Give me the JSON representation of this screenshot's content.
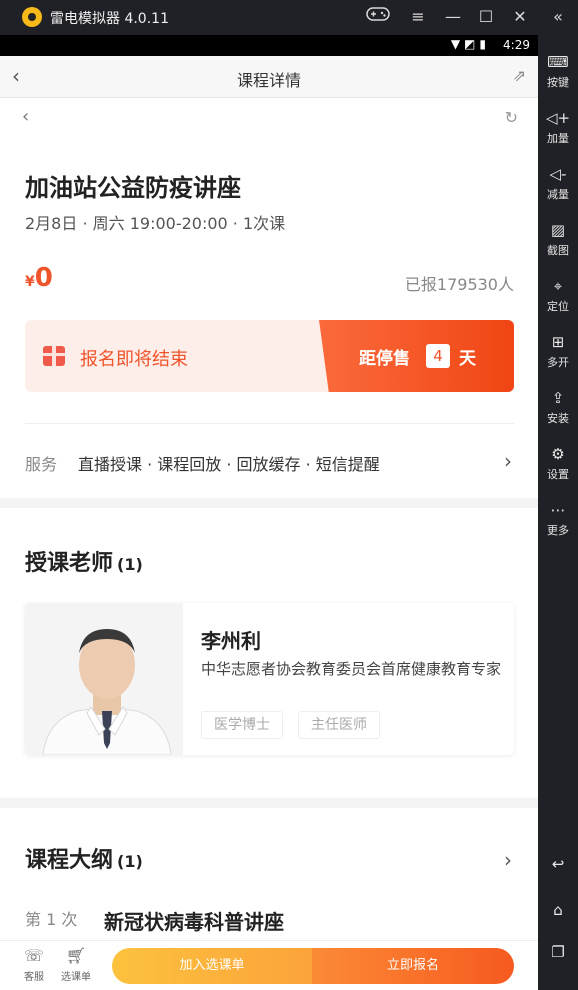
{
  "emulator": {
    "title": "雷电模拟器 4.0.11",
    "title_buttons": [
      "gamepad-icon",
      "menu-icon",
      "minimize-icon",
      "maximize-icon",
      "close-icon",
      "collapse-icon"
    ],
    "sidebar": [
      {
        "label": "按键",
        "icon": "keyboard-icon"
      },
      {
        "label": "加量",
        "icon": "volume-up-icon"
      },
      {
        "label": "减量",
        "icon": "volume-down-icon"
      },
      {
        "label": "截图",
        "icon": "screenshot-icon"
      },
      {
        "label": "定位",
        "icon": "location-icon"
      },
      {
        "label": "多开",
        "icon": "multi-instance-icon"
      },
      {
        "label": "安装",
        "icon": "install-icon"
      },
      {
        "label": "设置",
        "icon": "settings-icon"
      },
      {
        "label": "更多",
        "icon": "more-icon"
      }
    ]
  },
  "status": {
    "time": "4:29"
  },
  "appbar": {
    "title": "课程详情"
  },
  "course": {
    "title": "加油站公益防疫讲座",
    "meta": "2月8日 · 周六 19:00-20:00 · 1次课",
    "currency": "¥",
    "price": "0",
    "enrolled": "已报179530人"
  },
  "deadline": {
    "message": "报名即将结束",
    "countdown_prefix": "距停售",
    "countdown_days": "4",
    "countdown_unit": "天"
  },
  "service": {
    "label": "服务",
    "value": "直播授课 · 课程回放 · 回放缓存 · 短信提醒"
  },
  "teachers": {
    "title": "授课老师",
    "count": "(1)",
    "items": [
      {
        "name": "李州利",
        "description": "中华志愿者协会教育委员会首席健康教育专家",
        "tags": [
          "医学博士",
          "主任医师"
        ]
      }
    ]
  },
  "outline": {
    "title": "课程大纲",
    "count": "(1)",
    "lessons": [
      {
        "number": "第 1 次",
        "name": "新冠状病毒科普讲座"
      }
    ]
  },
  "bottom": {
    "service_label": "客服",
    "cart_label": "选课单",
    "add_label": "加入选课单",
    "enroll_label": "立即报名"
  },
  "colors": {
    "accent": "#f0542b",
    "emulator_bg": "#202126",
    "add_button": "#fcb33c",
    "enroll_button": "#f76a28"
  }
}
